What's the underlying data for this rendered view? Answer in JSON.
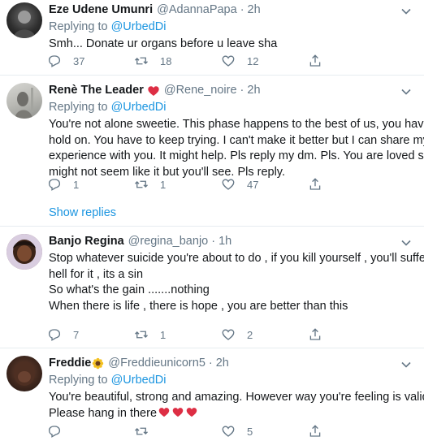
{
  "tweets": [
    {
      "name": "Eze Udene Umunri",
      "handle": "@AdannaPapa",
      "time": "2h",
      "replying_prefix": "Replying to ",
      "replying_to": "@UrbedDi",
      "lines": [
        "Smh... Donate ur organs before u leave sha"
      ],
      "replies": "37",
      "retweets": "18",
      "likes": "12"
    },
    {
      "name": "Renè The Leader",
      "handle": "@Rene_noire",
      "time": "2h",
      "replying_prefix": "Replying to ",
      "replying_to": "@UrbedDi",
      "lines": [
        "You're not alone sweetie. This phase happens to the best of us, you have to",
        "hold on. You have to keep trying. I can't make it better but I can share my",
        "experience with you. It might help. Pls reply my dm. Pls. You are loved sis it",
        "might not seem like it but you'll see. Pls reply."
      ],
      "replies": "1",
      "retweets": "1",
      "likes": "47",
      "show_replies": "Show replies"
    },
    {
      "name": "Banjo Regina",
      "handle": "@regina_banjo",
      "time": "1h",
      "lines": [
        "Stop whatever suicide you're about to do , if you kill yourself , you'll suffer in",
        "hell for it , its a sin",
        "So what's the gain .......nothing",
        "When there is life , there is hope , you are better than this"
      ],
      "replies": "7",
      "retweets": "1",
      "likes": "2"
    },
    {
      "name": "Freddie",
      "handle": "@Freddieunicorn5",
      "time": "2h",
      "replying_prefix": "Replying to ",
      "replying_to": "@UrbedDi",
      "lines": [
        "You're beautiful, strong and amazing. However way you're feeling is valid",
        "Please hang in there"
      ],
      "replies": "",
      "retweets": "",
      "likes": "5"
    }
  ],
  "icons": {
    "reply": "reply-icon",
    "retweet": "retweet-icon",
    "like": "heart-icon",
    "share": "share-icon",
    "more": "chevron-down-icon"
  },
  "colors": {
    "link": "#1b95e0",
    "muted": "#657786",
    "text": "#14171a",
    "divider": "#e6ecf0",
    "heart": "#e0245e"
  }
}
